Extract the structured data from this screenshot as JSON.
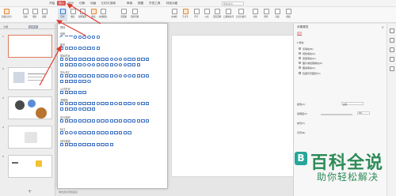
{
  "titlebar": {
    "menus": [
      "开始",
      "插入",
      "设计",
      "切换",
      "动画",
      "幻灯片放映",
      "审阅",
      "视图",
      "开发工具",
      "特色功能"
    ],
    "active_menu": "插入",
    "search_placeholder": "查找命令"
  },
  "ribbon": {
    "buttons": [
      "新建幻灯片",
      "表格",
      "图片",
      "截屏",
      "形状",
      "图标",
      "智能图形",
      "图表",
      "在线图表",
      "流程图",
      "思维导图",
      "文本框",
      "艺术字",
      "符号",
      "公式",
      "页眉页脚",
      "日期和时间",
      "幻灯片编号",
      "对象",
      "附件",
      "音频",
      "视频"
    ]
  },
  "left_panel": {
    "tabs": [
      "大纲",
      "幻灯片"
    ],
    "selected_tab": "幻灯片",
    "slides": [
      "1",
      "2",
      "3",
      "4",
      "5"
    ],
    "new_slide_symbol": "+"
  },
  "shapes_dropdown": {
    "sections": [
      "预设",
      "线条",
      "矩形",
      "基本形状",
      "箭头总汇",
      "公式形状",
      "流程图",
      "星与旗帜",
      "标注",
      "动作按钮"
    ]
  },
  "notes": {
    "placeholder": "单击此处添加备注"
  },
  "right_panel": {
    "title": "对象属性",
    "close_symbol": "×",
    "tab": "填充",
    "section_fill": "▾ 填充",
    "options": [
      "无填充(N)",
      "纯色填充(S)",
      "渐变填充(G)",
      "图片或纹理填充(P)",
      "图案填充(A)",
      "隐藏背景图形(H)"
    ],
    "selected_option": 1,
    "labels": [
      "颜色(C)",
      "透明度(T)",
      "前景(F)",
      "背景(B)"
    ],
    "color_value": "白色",
    "transparency_value": "0%"
  },
  "watermark": {
    "logo": "B",
    "main": "百科全说",
    "sub": "助你轻松解决"
  },
  "colors": {
    "accent": "#d9534f",
    "arrow": "#e0392e",
    "watermark": "#2e8b57"
  }
}
